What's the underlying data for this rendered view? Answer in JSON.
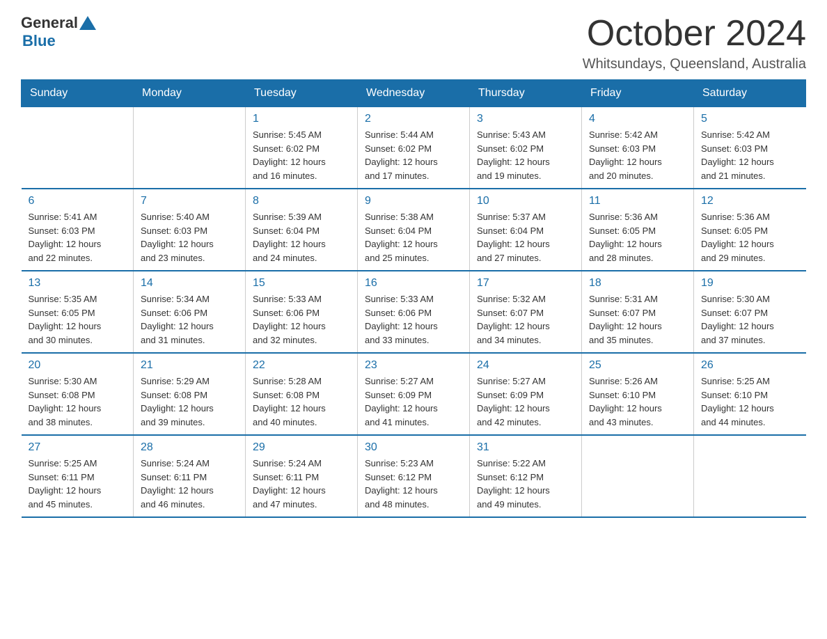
{
  "header": {
    "logo_general": "General",
    "logo_blue": "Blue",
    "month_year": "October 2024",
    "location": "Whitsundays, Queensland, Australia"
  },
  "days_of_week": [
    "Sunday",
    "Monday",
    "Tuesday",
    "Wednesday",
    "Thursday",
    "Friday",
    "Saturday"
  ],
  "weeks": [
    [
      {
        "day": "",
        "info": ""
      },
      {
        "day": "",
        "info": ""
      },
      {
        "day": "1",
        "info": "Sunrise: 5:45 AM\nSunset: 6:02 PM\nDaylight: 12 hours\nand 16 minutes."
      },
      {
        "day": "2",
        "info": "Sunrise: 5:44 AM\nSunset: 6:02 PM\nDaylight: 12 hours\nand 17 minutes."
      },
      {
        "day": "3",
        "info": "Sunrise: 5:43 AM\nSunset: 6:02 PM\nDaylight: 12 hours\nand 19 minutes."
      },
      {
        "day": "4",
        "info": "Sunrise: 5:42 AM\nSunset: 6:03 PM\nDaylight: 12 hours\nand 20 minutes."
      },
      {
        "day": "5",
        "info": "Sunrise: 5:42 AM\nSunset: 6:03 PM\nDaylight: 12 hours\nand 21 minutes."
      }
    ],
    [
      {
        "day": "6",
        "info": "Sunrise: 5:41 AM\nSunset: 6:03 PM\nDaylight: 12 hours\nand 22 minutes."
      },
      {
        "day": "7",
        "info": "Sunrise: 5:40 AM\nSunset: 6:03 PM\nDaylight: 12 hours\nand 23 minutes."
      },
      {
        "day": "8",
        "info": "Sunrise: 5:39 AM\nSunset: 6:04 PM\nDaylight: 12 hours\nand 24 minutes."
      },
      {
        "day": "9",
        "info": "Sunrise: 5:38 AM\nSunset: 6:04 PM\nDaylight: 12 hours\nand 25 minutes."
      },
      {
        "day": "10",
        "info": "Sunrise: 5:37 AM\nSunset: 6:04 PM\nDaylight: 12 hours\nand 27 minutes."
      },
      {
        "day": "11",
        "info": "Sunrise: 5:36 AM\nSunset: 6:05 PM\nDaylight: 12 hours\nand 28 minutes."
      },
      {
        "day": "12",
        "info": "Sunrise: 5:36 AM\nSunset: 6:05 PM\nDaylight: 12 hours\nand 29 minutes."
      }
    ],
    [
      {
        "day": "13",
        "info": "Sunrise: 5:35 AM\nSunset: 6:05 PM\nDaylight: 12 hours\nand 30 minutes."
      },
      {
        "day": "14",
        "info": "Sunrise: 5:34 AM\nSunset: 6:06 PM\nDaylight: 12 hours\nand 31 minutes."
      },
      {
        "day": "15",
        "info": "Sunrise: 5:33 AM\nSunset: 6:06 PM\nDaylight: 12 hours\nand 32 minutes."
      },
      {
        "day": "16",
        "info": "Sunrise: 5:33 AM\nSunset: 6:06 PM\nDaylight: 12 hours\nand 33 minutes."
      },
      {
        "day": "17",
        "info": "Sunrise: 5:32 AM\nSunset: 6:07 PM\nDaylight: 12 hours\nand 34 minutes."
      },
      {
        "day": "18",
        "info": "Sunrise: 5:31 AM\nSunset: 6:07 PM\nDaylight: 12 hours\nand 35 minutes."
      },
      {
        "day": "19",
        "info": "Sunrise: 5:30 AM\nSunset: 6:07 PM\nDaylight: 12 hours\nand 37 minutes."
      }
    ],
    [
      {
        "day": "20",
        "info": "Sunrise: 5:30 AM\nSunset: 6:08 PM\nDaylight: 12 hours\nand 38 minutes."
      },
      {
        "day": "21",
        "info": "Sunrise: 5:29 AM\nSunset: 6:08 PM\nDaylight: 12 hours\nand 39 minutes."
      },
      {
        "day": "22",
        "info": "Sunrise: 5:28 AM\nSunset: 6:08 PM\nDaylight: 12 hours\nand 40 minutes."
      },
      {
        "day": "23",
        "info": "Sunrise: 5:27 AM\nSunset: 6:09 PM\nDaylight: 12 hours\nand 41 minutes."
      },
      {
        "day": "24",
        "info": "Sunrise: 5:27 AM\nSunset: 6:09 PM\nDaylight: 12 hours\nand 42 minutes."
      },
      {
        "day": "25",
        "info": "Sunrise: 5:26 AM\nSunset: 6:10 PM\nDaylight: 12 hours\nand 43 minutes."
      },
      {
        "day": "26",
        "info": "Sunrise: 5:25 AM\nSunset: 6:10 PM\nDaylight: 12 hours\nand 44 minutes."
      }
    ],
    [
      {
        "day": "27",
        "info": "Sunrise: 5:25 AM\nSunset: 6:11 PM\nDaylight: 12 hours\nand 45 minutes."
      },
      {
        "day": "28",
        "info": "Sunrise: 5:24 AM\nSunset: 6:11 PM\nDaylight: 12 hours\nand 46 minutes."
      },
      {
        "day": "29",
        "info": "Sunrise: 5:24 AM\nSunset: 6:11 PM\nDaylight: 12 hours\nand 47 minutes."
      },
      {
        "day": "30",
        "info": "Sunrise: 5:23 AM\nSunset: 6:12 PM\nDaylight: 12 hours\nand 48 minutes."
      },
      {
        "day": "31",
        "info": "Sunrise: 5:22 AM\nSunset: 6:12 PM\nDaylight: 12 hours\nand 49 minutes."
      },
      {
        "day": "",
        "info": ""
      },
      {
        "day": "",
        "info": ""
      }
    ]
  ]
}
